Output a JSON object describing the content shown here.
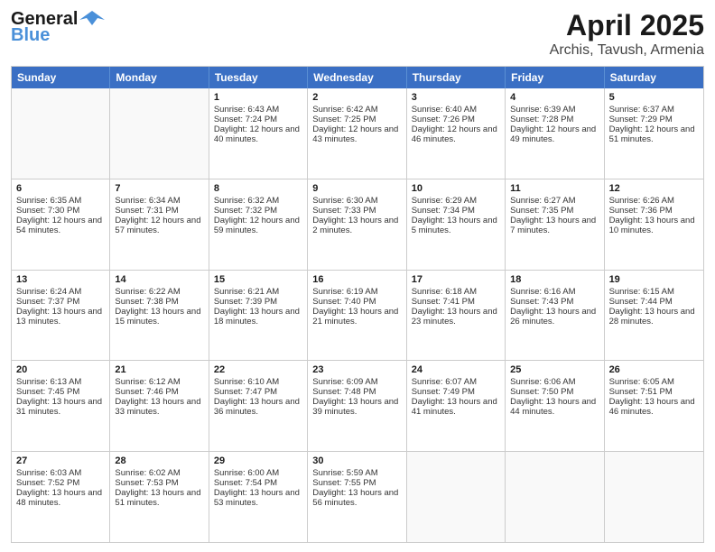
{
  "header": {
    "logo_line1": "General",
    "logo_line2": "Blue",
    "title": "April 2025",
    "subtitle": "Archis, Tavush, Armenia"
  },
  "days_of_week": [
    "Sunday",
    "Monday",
    "Tuesday",
    "Wednesday",
    "Thursday",
    "Friday",
    "Saturday"
  ],
  "weeks": [
    [
      {
        "day": "",
        "sunrise": "",
        "sunset": "",
        "daylight": ""
      },
      {
        "day": "",
        "sunrise": "",
        "sunset": "",
        "daylight": ""
      },
      {
        "day": "1",
        "sunrise": "Sunrise: 6:43 AM",
        "sunset": "Sunset: 7:24 PM",
        "daylight": "Daylight: 12 hours and 40 minutes."
      },
      {
        "day": "2",
        "sunrise": "Sunrise: 6:42 AM",
        "sunset": "Sunset: 7:25 PM",
        "daylight": "Daylight: 12 hours and 43 minutes."
      },
      {
        "day": "3",
        "sunrise": "Sunrise: 6:40 AM",
        "sunset": "Sunset: 7:26 PM",
        "daylight": "Daylight: 12 hours and 46 minutes."
      },
      {
        "day": "4",
        "sunrise": "Sunrise: 6:39 AM",
        "sunset": "Sunset: 7:28 PM",
        "daylight": "Daylight: 12 hours and 49 minutes."
      },
      {
        "day": "5",
        "sunrise": "Sunrise: 6:37 AM",
        "sunset": "Sunset: 7:29 PM",
        "daylight": "Daylight: 12 hours and 51 minutes."
      }
    ],
    [
      {
        "day": "6",
        "sunrise": "Sunrise: 6:35 AM",
        "sunset": "Sunset: 7:30 PM",
        "daylight": "Daylight: 12 hours and 54 minutes."
      },
      {
        "day": "7",
        "sunrise": "Sunrise: 6:34 AM",
        "sunset": "Sunset: 7:31 PM",
        "daylight": "Daylight: 12 hours and 57 minutes."
      },
      {
        "day": "8",
        "sunrise": "Sunrise: 6:32 AM",
        "sunset": "Sunset: 7:32 PM",
        "daylight": "Daylight: 12 hours and 59 minutes."
      },
      {
        "day": "9",
        "sunrise": "Sunrise: 6:30 AM",
        "sunset": "Sunset: 7:33 PM",
        "daylight": "Daylight: 13 hours and 2 minutes."
      },
      {
        "day": "10",
        "sunrise": "Sunrise: 6:29 AM",
        "sunset": "Sunset: 7:34 PM",
        "daylight": "Daylight: 13 hours and 5 minutes."
      },
      {
        "day": "11",
        "sunrise": "Sunrise: 6:27 AM",
        "sunset": "Sunset: 7:35 PM",
        "daylight": "Daylight: 13 hours and 7 minutes."
      },
      {
        "day": "12",
        "sunrise": "Sunrise: 6:26 AM",
        "sunset": "Sunset: 7:36 PM",
        "daylight": "Daylight: 13 hours and 10 minutes."
      }
    ],
    [
      {
        "day": "13",
        "sunrise": "Sunrise: 6:24 AM",
        "sunset": "Sunset: 7:37 PM",
        "daylight": "Daylight: 13 hours and 13 minutes."
      },
      {
        "day": "14",
        "sunrise": "Sunrise: 6:22 AM",
        "sunset": "Sunset: 7:38 PM",
        "daylight": "Daylight: 13 hours and 15 minutes."
      },
      {
        "day": "15",
        "sunrise": "Sunrise: 6:21 AM",
        "sunset": "Sunset: 7:39 PM",
        "daylight": "Daylight: 13 hours and 18 minutes."
      },
      {
        "day": "16",
        "sunrise": "Sunrise: 6:19 AM",
        "sunset": "Sunset: 7:40 PM",
        "daylight": "Daylight: 13 hours and 21 minutes."
      },
      {
        "day": "17",
        "sunrise": "Sunrise: 6:18 AM",
        "sunset": "Sunset: 7:41 PM",
        "daylight": "Daylight: 13 hours and 23 minutes."
      },
      {
        "day": "18",
        "sunrise": "Sunrise: 6:16 AM",
        "sunset": "Sunset: 7:43 PM",
        "daylight": "Daylight: 13 hours and 26 minutes."
      },
      {
        "day": "19",
        "sunrise": "Sunrise: 6:15 AM",
        "sunset": "Sunset: 7:44 PM",
        "daylight": "Daylight: 13 hours and 28 minutes."
      }
    ],
    [
      {
        "day": "20",
        "sunrise": "Sunrise: 6:13 AM",
        "sunset": "Sunset: 7:45 PM",
        "daylight": "Daylight: 13 hours and 31 minutes."
      },
      {
        "day": "21",
        "sunrise": "Sunrise: 6:12 AM",
        "sunset": "Sunset: 7:46 PM",
        "daylight": "Daylight: 13 hours and 33 minutes."
      },
      {
        "day": "22",
        "sunrise": "Sunrise: 6:10 AM",
        "sunset": "Sunset: 7:47 PM",
        "daylight": "Daylight: 13 hours and 36 minutes."
      },
      {
        "day": "23",
        "sunrise": "Sunrise: 6:09 AM",
        "sunset": "Sunset: 7:48 PM",
        "daylight": "Daylight: 13 hours and 39 minutes."
      },
      {
        "day": "24",
        "sunrise": "Sunrise: 6:07 AM",
        "sunset": "Sunset: 7:49 PM",
        "daylight": "Daylight: 13 hours and 41 minutes."
      },
      {
        "day": "25",
        "sunrise": "Sunrise: 6:06 AM",
        "sunset": "Sunset: 7:50 PM",
        "daylight": "Daylight: 13 hours and 44 minutes."
      },
      {
        "day": "26",
        "sunrise": "Sunrise: 6:05 AM",
        "sunset": "Sunset: 7:51 PM",
        "daylight": "Daylight: 13 hours and 46 minutes."
      }
    ],
    [
      {
        "day": "27",
        "sunrise": "Sunrise: 6:03 AM",
        "sunset": "Sunset: 7:52 PM",
        "daylight": "Daylight: 13 hours and 48 minutes."
      },
      {
        "day": "28",
        "sunrise": "Sunrise: 6:02 AM",
        "sunset": "Sunset: 7:53 PM",
        "daylight": "Daylight: 13 hours and 51 minutes."
      },
      {
        "day": "29",
        "sunrise": "Sunrise: 6:00 AM",
        "sunset": "Sunset: 7:54 PM",
        "daylight": "Daylight: 13 hours and 53 minutes."
      },
      {
        "day": "30",
        "sunrise": "Sunrise: 5:59 AM",
        "sunset": "Sunset: 7:55 PM",
        "daylight": "Daylight: 13 hours and 56 minutes."
      },
      {
        "day": "",
        "sunrise": "",
        "sunset": "",
        "daylight": ""
      },
      {
        "day": "",
        "sunrise": "",
        "sunset": "",
        "daylight": ""
      },
      {
        "day": "",
        "sunrise": "",
        "sunset": "",
        "daylight": ""
      }
    ]
  ]
}
